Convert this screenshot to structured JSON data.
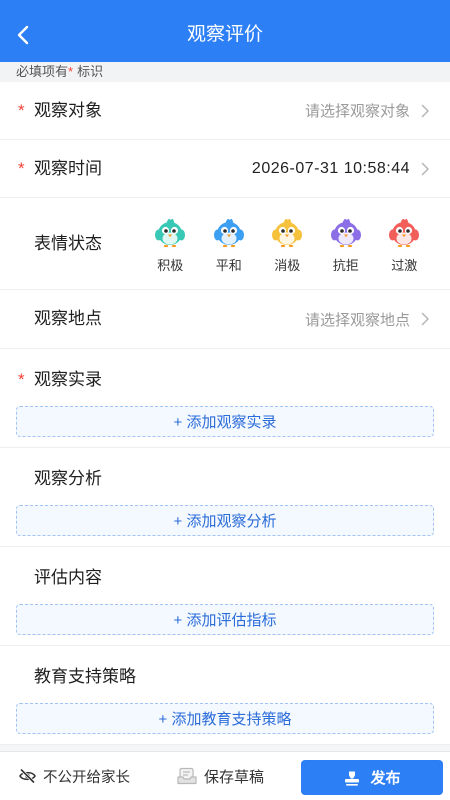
{
  "header": {
    "title": "观察评价",
    "back_icon": "chevron-left-icon"
  },
  "notice": {
    "prefix": "必填项有",
    "mark": "*",
    "suffix": "标识"
  },
  "colors": {
    "primary": "#2d7ff5",
    "required": "#f0443a",
    "placeholder": "#9a9a9a",
    "dashed_border": "#a3c3f3",
    "dashed_background": "#f4f8ff",
    "button_text": "#2a6cd8"
  },
  "form": {
    "subject": {
      "required": "*",
      "label": "观察对象",
      "placeholder": "请选择观察对象",
      "icon": "chevron-right-icon"
    },
    "time": {
      "required": "*",
      "label": "观察时间",
      "value": "2026-07-31 10:58:44",
      "icon": "chevron-right-icon"
    },
    "emotion": {
      "label": "表情状态",
      "options": [
        {
          "label": "积极",
          "icon": "teal-bird-icon",
          "color": "#38c8b5"
        },
        {
          "label": "平和",
          "icon": "blue-bird-icon",
          "color": "#3c9ff2"
        },
        {
          "label": "消极",
          "icon": "yellow-bird-icon",
          "color": "#f6c23e"
        },
        {
          "label": "抗拒",
          "icon": "purple-bird-icon",
          "color": "#8c6fe6"
        },
        {
          "label": "过激",
          "icon": "red-bird-icon",
          "color": "#f25e5a"
        }
      ]
    },
    "location": {
      "label": "观察地点",
      "placeholder": "请选择观察地点",
      "icon": "chevron-right-icon"
    },
    "sections": [
      {
        "required": "*",
        "label": "观察实录",
        "button": "+ 添加观察实录"
      },
      {
        "label": "观察分析",
        "button": "+ 添加观察分析"
      },
      {
        "label": "评估内容",
        "button": "+ 添加评估指标"
      },
      {
        "label": "教育支持策略",
        "button": "+ 添加教育支持策略"
      }
    ]
  },
  "footer": {
    "private": {
      "icon": "eye-slash-icon",
      "label": "不公开给家长"
    },
    "draft": {
      "icon": "draft-icon",
      "label": "保存草稿"
    },
    "publish": {
      "icon": "publish-icon",
      "label": "发布"
    }
  }
}
